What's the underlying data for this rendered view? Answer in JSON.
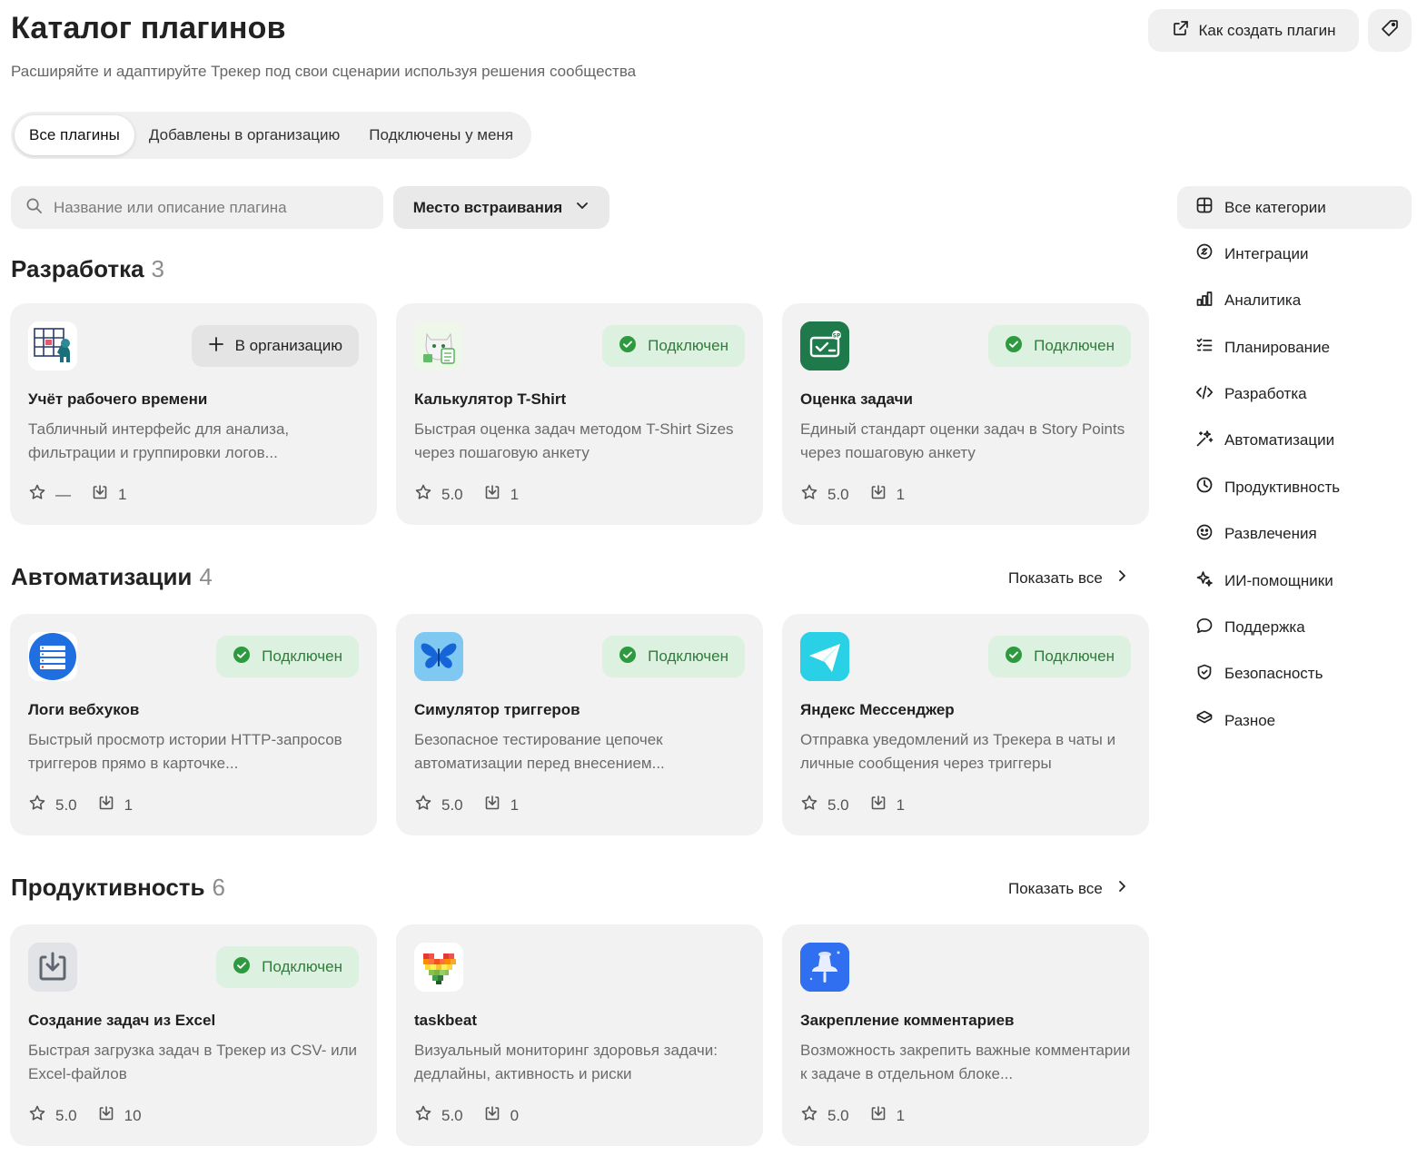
{
  "header": {
    "title": "Каталог плагинов",
    "subtitle": "Расширяйте и адаптируйте Трекер под свои сценарии используя решения сообщества",
    "create_plugin_label": "Как создать плагин"
  },
  "tabs": [
    {
      "label": "Все плагины",
      "active": true
    },
    {
      "label": "Добавлены в организацию",
      "active": false
    },
    {
      "label": "Подключены у меня",
      "active": false
    }
  ],
  "filters": {
    "search_placeholder": "Название или описание плагина",
    "embed_dropdown_label": "Место встраивания"
  },
  "colors": {
    "connected_bg": "#dcf1df",
    "connected_text": "#2e7d3a",
    "card_bg": "#f2f2f3"
  },
  "sections": [
    {
      "title": "Разработка",
      "count": "3",
      "show_all": "",
      "plugins": [
        {
          "name": "Учёт рабочего времени",
          "desc": "Табличный интерфейс для анализа, фильтрации и группировки логов...",
          "rating": "—",
          "installs": "1",
          "status": "В организацию",
          "status_type": "add",
          "logo": "timesheet-grid-icon"
        },
        {
          "name": "Калькулятор T-Shirt",
          "desc": "Быстрая оценка задач методом T-Shirt Sizes через пошаговую анкету",
          "rating": "5.0",
          "installs": "1",
          "status": "Подключен",
          "status_type": "connected",
          "logo": "cat-tshirt-icon"
        },
        {
          "name": "Оценка задачи",
          "desc": "Единый стандарт оценки задач в Story Points через пошаговую анкету",
          "rating": "5.0",
          "installs": "1",
          "status": "Подключен",
          "status_type": "connected",
          "logo": "story-points-icon"
        }
      ]
    },
    {
      "title": "Автоматизации",
      "count": "4",
      "show_all": "Показать все",
      "plugins": [
        {
          "name": "Логи вебхуков",
          "desc": "Быстрый просмотр истории HTTP-запросов триггеров прямо в карточке...",
          "rating": "5.0",
          "installs": "1",
          "status": "Подключен",
          "status_type": "connected",
          "logo": "server-list-icon"
        },
        {
          "name": "Симулятор триггеров",
          "desc": "Безопасное тестирование цепочек автоматизации перед внесением...",
          "rating": "5.0",
          "installs": "1",
          "status": "Подключен",
          "status_type": "connected",
          "logo": "butterfly-icon"
        },
        {
          "name": "Яндекс Мессенджер",
          "desc": "Отправка уведомлений из Трекера в чаты и личные сообщения через триггеры",
          "rating": "5.0",
          "installs": "1",
          "status": "Подключен",
          "status_type": "connected",
          "logo": "paper-plane-icon"
        }
      ]
    },
    {
      "title": "Продуктивность",
      "count": "6",
      "show_all": "Показать все",
      "plugins": [
        {
          "name": "Создание задач из Excel",
          "desc": "Быстрая загрузка задач в Трекер из CSV- или Excel-файлов",
          "rating": "5.0",
          "installs": "10",
          "status": "Подключен",
          "status_type": "connected",
          "logo": "download-tray-icon"
        },
        {
          "name": "taskbeat",
          "desc": "Визуальный мониторинг здоровья задачи: дедлайны, активность и риски",
          "rating": "5.0",
          "installs": "0",
          "status": "",
          "status_type": "none",
          "logo": "pixel-heart-icon"
        },
        {
          "name": "Закрепление комментариев",
          "desc": "Возможность закрепить важные комментарии к задаче в отдельном блоке...",
          "rating": "5.0",
          "installs": "1",
          "status": "",
          "status_type": "none",
          "logo": "pushpin-icon"
        }
      ]
    }
  ],
  "sidebar": [
    {
      "label": "Все категории",
      "icon": "grid-icon",
      "active": true
    },
    {
      "label": "Интеграции",
      "icon": "integration-icon",
      "active": false
    },
    {
      "label": "Аналитика",
      "icon": "bar-chart-icon",
      "active": false
    },
    {
      "label": "Планирование",
      "icon": "checklist-icon",
      "active": false
    },
    {
      "label": "Разработка",
      "icon": "code-icon",
      "active": false
    },
    {
      "label": "Автоматизации",
      "icon": "magic-wand-icon",
      "active": false
    },
    {
      "label": "Продуктивность",
      "icon": "clock-icon",
      "active": false
    },
    {
      "label": "Развлечения",
      "icon": "smile-icon",
      "active": false
    },
    {
      "label": "ИИ-помощники",
      "icon": "sparkles-icon",
      "active": false
    },
    {
      "label": "Поддержка",
      "icon": "chat-bubble-icon",
      "active": false
    },
    {
      "label": "Безопасность",
      "icon": "shield-icon",
      "active": false
    },
    {
      "label": "Разное",
      "icon": "layers-icon",
      "active": false
    }
  ]
}
